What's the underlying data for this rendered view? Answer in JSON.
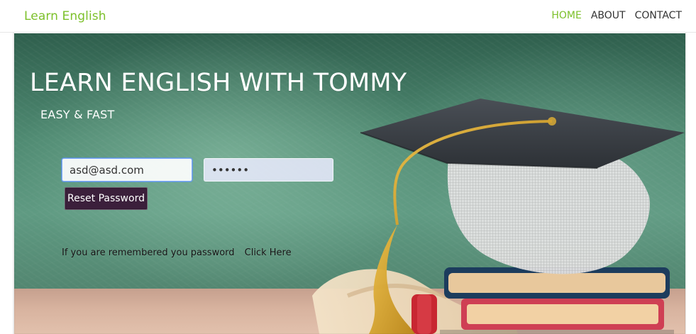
{
  "navbar": {
    "brand": "Learn English",
    "items": [
      {
        "label": "HOME",
        "active": true
      },
      {
        "label": "ABOUT",
        "active": false
      },
      {
        "label": "CONTACT",
        "active": false
      }
    ],
    "colors": {
      "brand": "#7cc02a",
      "active": "#7cc02a",
      "link": "#333333"
    }
  },
  "hero": {
    "title": "LEARN ENGLISH WITH TOMMY",
    "subtitle": "EASY & FAST",
    "form": {
      "email_value": "asd@asd.com",
      "password_value": "••••••",
      "reset_button_label": "Reset Password"
    },
    "remember_text": "If you are remembered you password",
    "remember_link": "Click Here"
  },
  "icons": {
    "art": "graduation-cap-books-diploma"
  }
}
